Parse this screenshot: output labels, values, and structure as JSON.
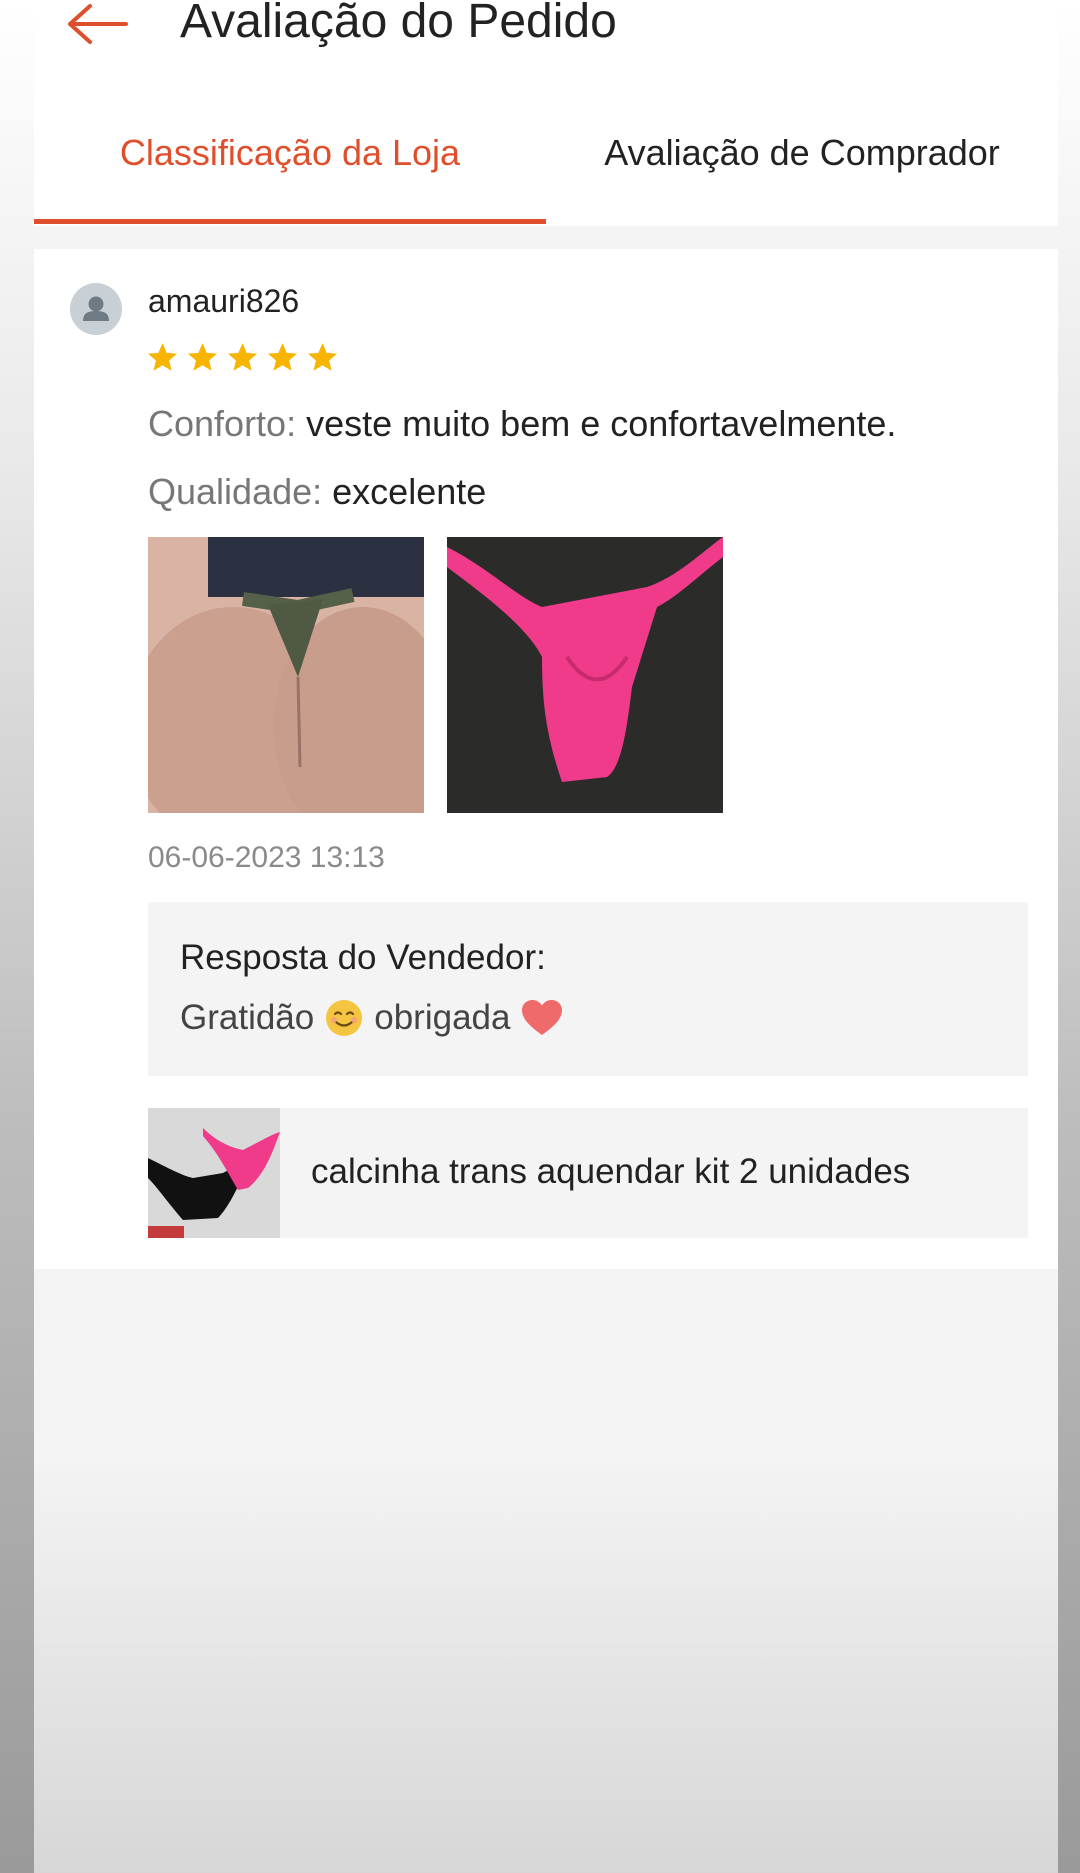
{
  "header": {
    "title": "Avaliação do Pedido",
    "back_icon": "arrow-left-icon"
  },
  "tabs": [
    {
      "label": "Classificação da Loja",
      "active": true
    },
    {
      "label": "Avaliação de Comprador",
      "active": false
    }
  ],
  "colors": {
    "accent": "#e04f2b",
    "star": "#f7b500"
  },
  "review": {
    "username": "amauri826",
    "rating": 5,
    "fields": [
      {
        "label": "Conforto:",
        "value": "veste muito bem e confortavelmente."
      },
      {
        "label": "Qualidade:",
        "value": "excelente"
      }
    ],
    "timestamp": "06-06-2023 13:13",
    "seller_reply": {
      "title": "Resposta do Vendedor:",
      "text_1": "Gratidão",
      "text_2": "obrigada"
    },
    "product": {
      "name": "calcinha trans aquendar kit 2 unidades"
    }
  }
}
